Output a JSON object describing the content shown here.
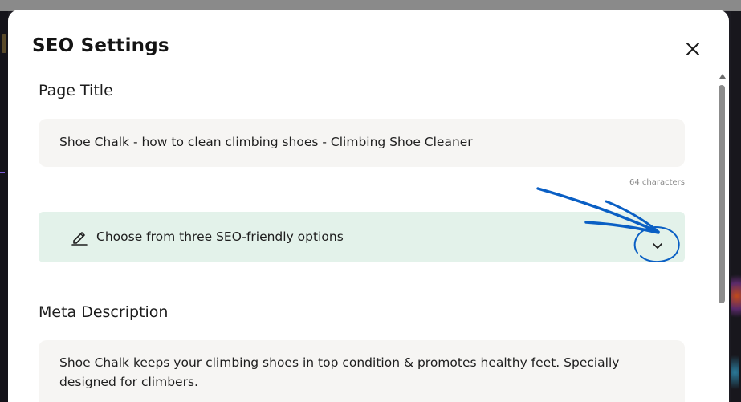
{
  "modal": {
    "title": "SEO Settings"
  },
  "page_title": {
    "label": "Page Title",
    "value": "Shoe Chalk - how to clean climbing shoes - Climbing Shoe Cleaner",
    "char_count": "64 characters"
  },
  "options": {
    "label": "Choose from three SEO-friendly options"
  },
  "meta_description": {
    "label": "Meta Description",
    "value": "Shoe Chalk keeps your climbing shoes in top condition & promotes healthy feet. Specially designed for climbers."
  },
  "colors": {
    "options_bg": "#e3f2ea",
    "annotation": "#0a5fc4"
  }
}
